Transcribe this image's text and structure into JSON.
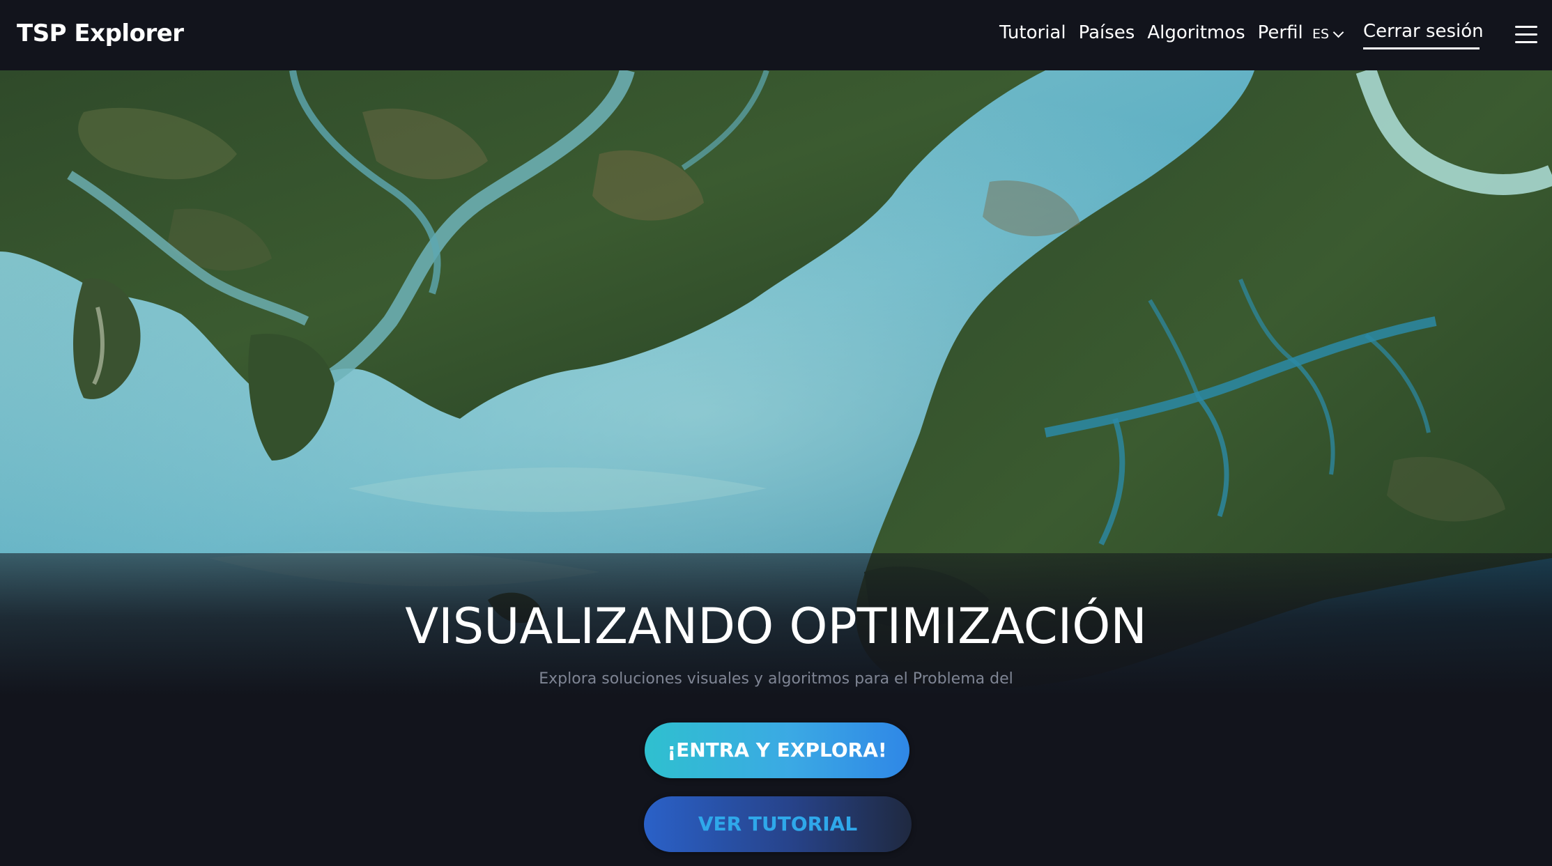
{
  "navbar": {
    "brand": "TSP Explorer",
    "links": [
      "Tutorial",
      "Países",
      "Algoritmos",
      "Perfil"
    ],
    "language": "ES",
    "logout": "Cerrar sesión",
    "menu_icon": "hamburger-menu-icon"
  },
  "hero": {
    "title": "VISUALIZANDO OPTIMIZACIÓN",
    "subtitle": "Explora soluciones visuales y algoritmos para el Problema del",
    "image": "satellite-river-delta-image"
  },
  "actions": {
    "primary_label": "¡ENTRA Y EXPLORA!",
    "secondary_label": "VER TUTORIAL"
  },
  "colors": {
    "background": "#12141c",
    "primary_gradient_start": "#2fc0cf",
    "primary_gradient_end": "#2f87e6",
    "secondary_text": "#2fa8ea"
  }
}
